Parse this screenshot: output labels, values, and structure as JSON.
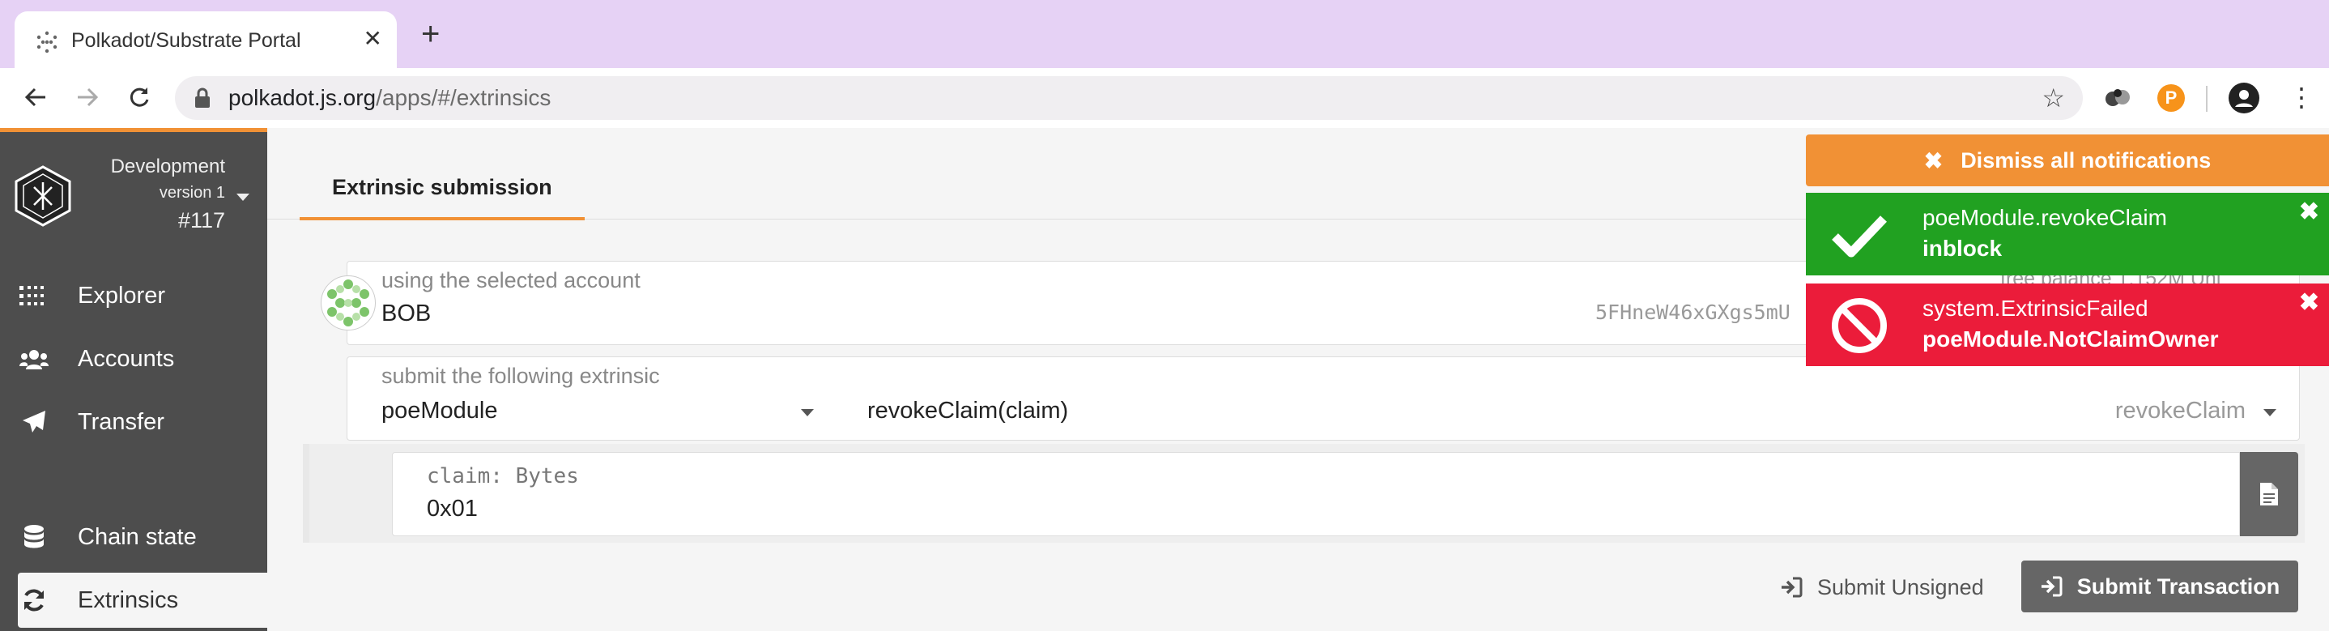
{
  "browser": {
    "tab_title": "Polkadot/Substrate Portal",
    "tab_close": "✕",
    "new_tab": "+",
    "url_domain": "polkadot.js.org",
    "url_path": "/apps/#/extrinsics",
    "ext_icon_letter": "P"
  },
  "sidebar": {
    "chain_name": "Development",
    "chain_version": "version 1",
    "block_number": "#117",
    "items": [
      {
        "label": "Explorer",
        "icon": "explorer-icon"
      },
      {
        "label": "Accounts",
        "icon": "users-icon"
      },
      {
        "label": "Transfer",
        "icon": "paper-plane-icon"
      },
      {
        "label": "Chain state",
        "icon": "database-icon"
      },
      {
        "label": "Extrinsics",
        "icon": "sync-icon",
        "active": true
      }
    ]
  },
  "main": {
    "tab_label": "Extrinsic submission",
    "account": {
      "label": "using the selected account",
      "name": "BOB",
      "address": "5FHneW46xGXgs5mU",
      "free_balance": "free balance 1.152M Uni"
    },
    "extrinsic": {
      "label": "submit the following extrinsic",
      "module": "poeModule",
      "method": "revokeClaim(claim)",
      "method_doc": "revokeClaim"
    },
    "param": {
      "label": "claim: Bytes",
      "value": "0x01"
    },
    "submit_unsigned_label": "Submit Unsigned",
    "submit_tx_label": "Submit Transaction"
  },
  "notifications": {
    "dismiss_all_label": "Dismiss all notifications",
    "items": [
      {
        "title": "poeModule.revokeClaim",
        "status": "inblock",
        "kind": "success",
        "color": "#21a121"
      },
      {
        "title": "system.ExtrinsicFailed",
        "status": "poeModule.NotClaimOwner",
        "kind": "error",
        "color": "#eb1c3a"
      }
    ]
  },
  "colors": {
    "accent": "#f19135",
    "sidebar_bg": "#4d4d4d",
    "tabbar_bg": "#e6d2f5"
  }
}
